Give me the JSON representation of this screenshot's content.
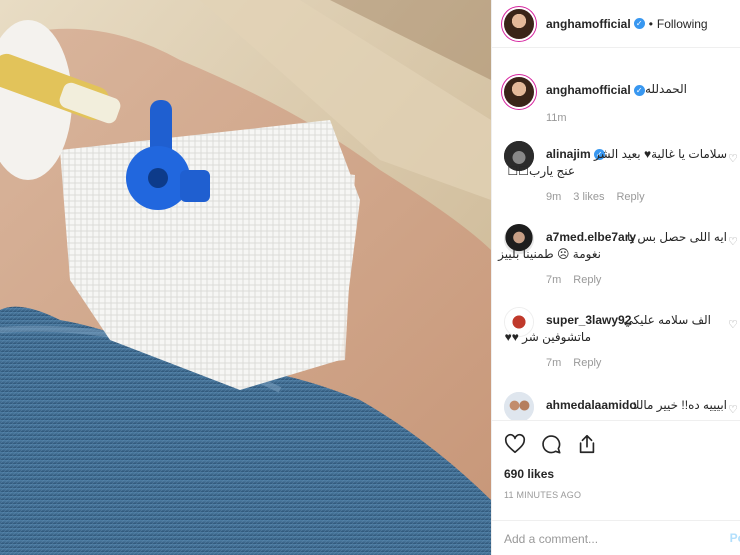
{
  "post": {
    "username": "anghamofficial",
    "follow_status": "Following",
    "separator": "•"
  },
  "caption": {
    "username": "anghamofficial",
    "text": "الحمدلله",
    "time": "11m"
  },
  "comments": [
    {
      "username": "alinajim",
      "verified": true,
      "text_line1": "سلامات يا غالية♥ بعيد الشر",
      "text_line2": "عنج يارب☐☐",
      "time": "9m",
      "likes": "3 likes",
      "reply": "Reply"
    },
    {
      "username": "a7med.elbe7ary",
      "verified": false,
      "text_line1": "ايه اللى حصل بس يا",
      "text_line2": "نغومة ☹ طمنينا بلييز",
      "time": "7m",
      "likes": "",
      "reply": "Reply"
    },
    {
      "username": "super_3lawy92",
      "verified": false,
      "text_line1": "الف سلامه عليكي",
      "text_line2": "ماتشوفين شر ♥♥",
      "time": "7m",
      "likes": "",
      "reply": "Reply"
    },
    {
      "username": "ahmedalaamido",
      "verified": false,
      "text_line1": "ابيييه ده!! خيير مالك",
      "text_line2": "",
      "time": "",
      "likes": "",
      "reply": ""
    }
  ],
  "likes_count": "690 likes",
  "timestamp": "11 MINUTES AGO",
  "add_comment": {
    "placeholder": "Add a comment...",
    "post_label": "Po"
  },
  "icons": {
    "like": "heart-icon",
    "comment": "comment-icon",
    "share": "share-icon",
    "verified": "verified-badge-icon"
  },
  "colors": {
    "verified": "#3897f0",
    "secondary_text": "#999999",
    "border": "#efefef"
  }
}
